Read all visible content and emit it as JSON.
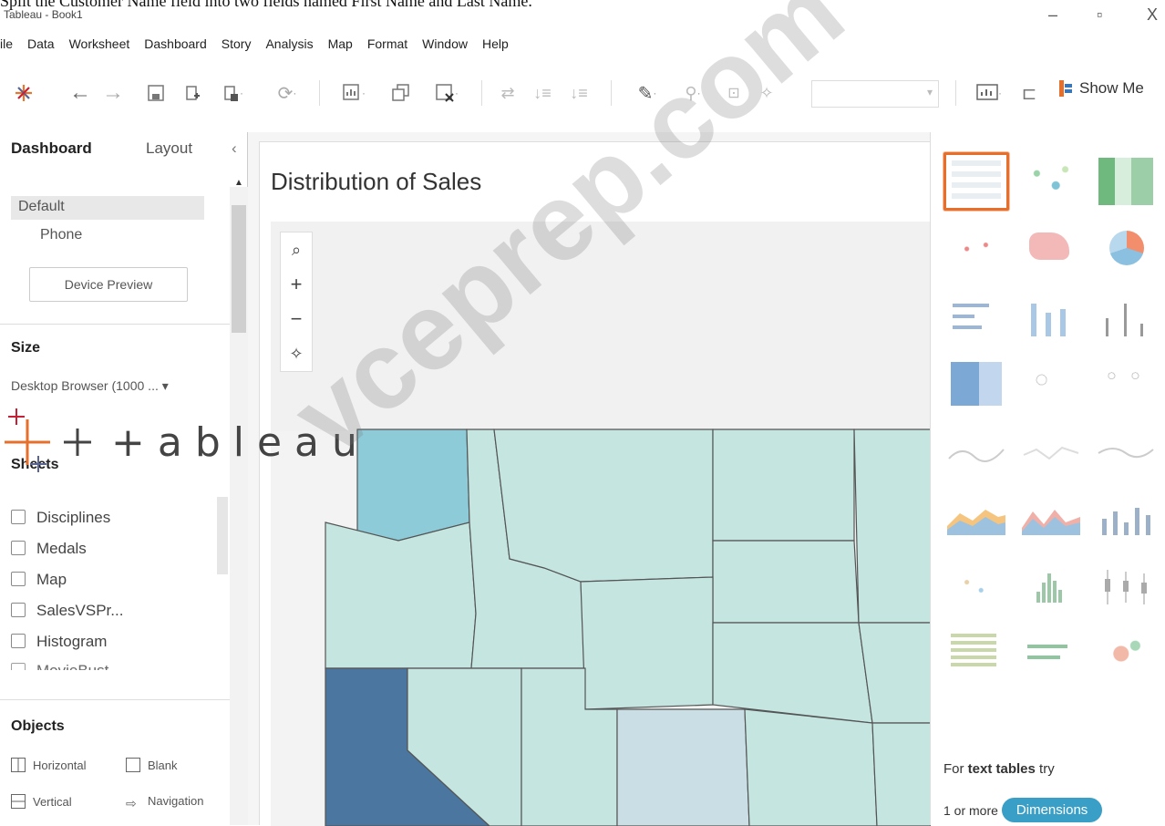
{
  "question": "Split the Customer Name field into two fields named First Name and Last Name.",
  "app_title": "Tableau - Book1",
  "menu": [
    "ile",
    "Data",
    "Worksheet",
    "Dashboard",
    "Story",
    "Analysis",
    "Map",
    "Format",
    "Window",
    "Help"
  ],
  "toolbar": {
    "show_me_label": "Show Me"
  },
  "left": {
    "tab_dashboard": "Dashboard",
    "tab_layout": "Layout",
    "devices": [
      "Default",
      "Phone"
    ],
    "device_preview": "Device Preview",
    "size_title": "Size",
    "size_value": "Desktop Browser (1000 ...",
    "sheets_title": "Sheets",
    "sheets": [
      "Disciplines",
      "Medals",
      "Map",
      "SalesVSPr...",
      "Histogram",
      "MovieBust"
    ],
    "objects_title": "Objects",
    "objects": [
      "Horizontal",
      "Blank",
      "Vertical",
      "Navigation"
    ]
  },
  "dashboard": {
    "title": "Distribution of Sales"
  },
  "showme": {
    "hint_prefix": "For ",
    "hint_bold": "text tables",
    "hint_suffix": " try",
    "dim_prefix": "1 or more",
    "dim_pill": "Dimensions"
  },
  "logo_text": "+ableau",
  "watermark": "vceprep.com",
  "colors": {
    "accent": "#e66f2b",
    "pill": "#3a9fc6",
    "map_light": "#c4e5e0",
    "map_mid": "#8ecbd8",
    "map_dark": "#4b76a0"
  }
}
